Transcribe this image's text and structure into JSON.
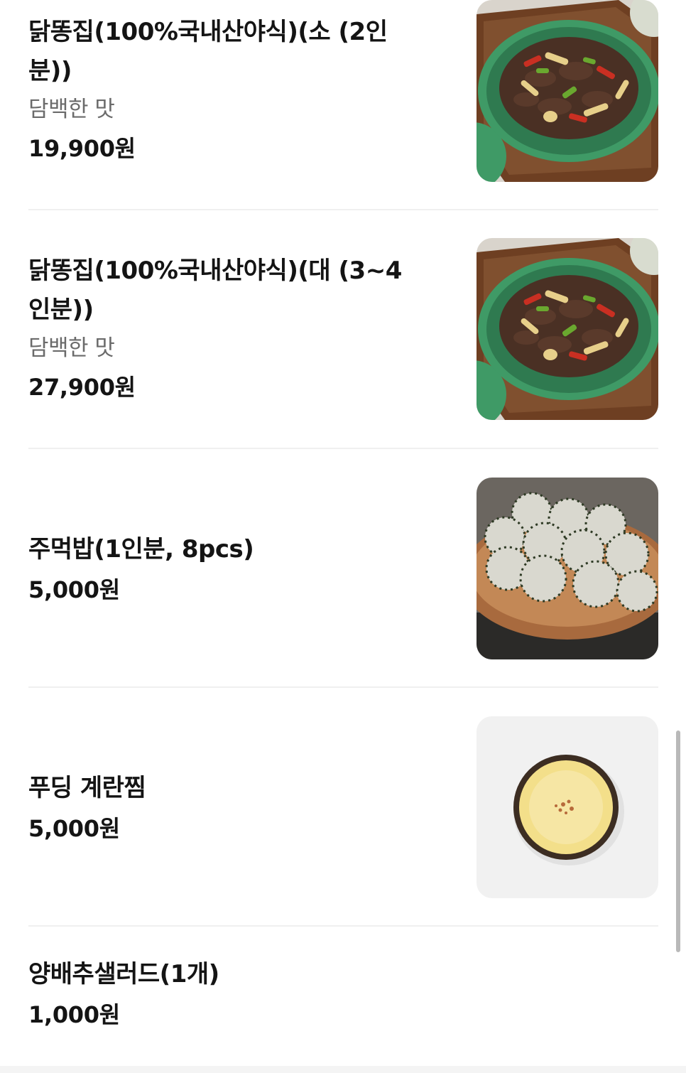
{
  "menu": {
    "items": [
      {
        "name_line1": "닭똥집(100%국내산야식)(소 (2인",
        "name_line2": "분))",
        "description": "담백한 맛",
        "price": "19,900원",
        "photo_icon": "stir-fried-gizzard-photo"
      },
      {
        "name_line1": "닭똥집(100%국내산야식)(대 (3~4",
        "name_line2": "인분))",
        "description": "담백한 맛",
        "price": "27,900원",
        "photo_icon": "stir-fried-gizzard-photo"
      },
      {
        "name_line1": "주먹밥(1인분, 8pcs)",
        "price": "5,000원",
        "photo_icon": "rice-balls-photo"
      },
      {
        "name_line1": "푸딩 계란찜",
        "price": "5,000원",
        "photo_icon": "steamed-egg-pudding-photo"
      },
      {
        "name_line1": "양배추샐러드(1개)",
        "price": "1,000원"
      }
    ]
  },
  "colors": {
    "text_primary": "#141414",
    "text_secondary": "#6b6b6b",
    "divider": "#f0f0f0",
    "plate_green": "#3f9a66",
    "wood_board": "#7a4a2b",
    "egg_yellow": "#f3df8a"
  }
}
